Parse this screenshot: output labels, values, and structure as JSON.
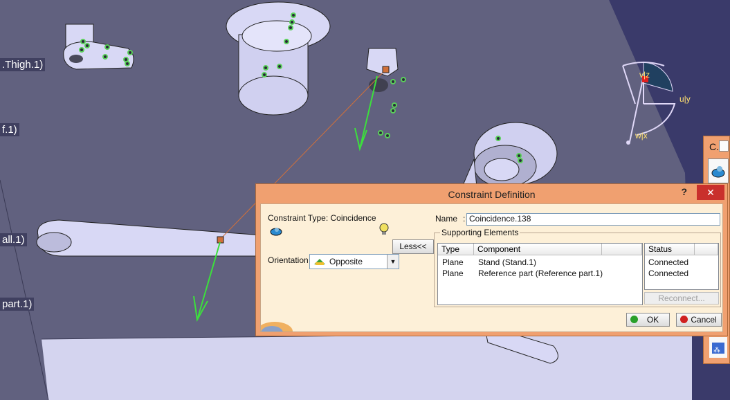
{
  "tree_labels": [
    ".Thigh.1)",
    "f.1)",
    "all.1)",
    "part.1)"
  ],
  "compass": {
    "labels": [
      "v|z",
      "u|y",
      "w|x"
    ]
  },
  "dialog": {
    "title": "Constraint Definition",
    "help": "?",
    "close": "✕",
    "constraint_type_label": "Constraint Type: Coincidence",
    "less_button": "Less<<",
    "orientation_label": "Orientation",
    "orientation_value": "Opposite",
    "name_label": "Name",
    "name_value": "Coincidence.138",
    "supporting_elements_label": "Supporting Elements",
    "columns": {
      "type": "Type",
      "component": "Component",
      "status": "Status"
    },
    "rows": [
      {
        "type": "Plane",
        "component": "Stand (Stand.1)",
        "status": "Connected"
      },
      {
        "type": "Plane",
        "component": "Reference part (Reference part.1)",
        "status": "Connected"
      }
    ],
    "reconnect_button": "Reconnect...",
    "ok_button": "OK",
    "cancel_button": "Cancel"
  },
  "side_panel": {
    "title": "C."
  },
  "colors": {
    "background": "#5a5a78",
    "part": "#d8d8f5",
    "dialog": "#f0a070",
    "accent_green": "#3ce03c",
    "axis_orange": "#d0703a"
  }
}
